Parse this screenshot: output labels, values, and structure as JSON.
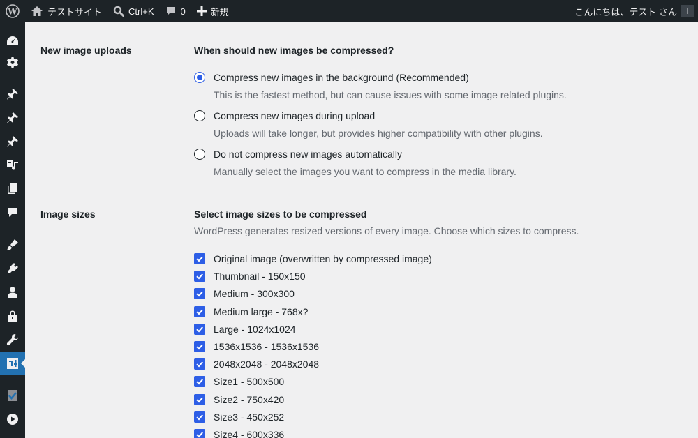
{
  "adminbar": {
    "site_name": "テストサイト",
    "search_shortcut": "Ctrl+K",
    "comments_count": "0",
    "new_label": "新規",
    "greeting": "こんにちは、テスト さん",
    "avatar_letter": "T"
  },
  "sidebar": {
    "items": [
      {
        "icon": "dashboard-icon"
      },
      {
        "icon": "gear-icon"
      },
      {
        "icon": "pin-icon"
      },
      {
        "icon": "pin-icon"
      },
      {
        "icon": "pin-icon"
      },
      {
        "icon": "media-icon"
      },
      {
        "icon": "pages-icon"
      },
      {
        "icon": "comments-icon"
      },
      {
        "icon": "appearance-icon"
      },
      {
        "icon": "plugins-icon"
      },
      {
        "icon": "users-icon"
      },
      {
        "icon": "lock-icon"
      },
      {
        "icon": "tools-icon"
      },
      {
        "icon": "settings-icon",
        "current": true
      },
      {
        "icon": "shield-check-icon"
      },
      {
        "icon": "play-icon"
      }
    ]
  },
  "new_uploads": {
    "label": "New image uploads",
    "question": "When should new images be compressed?",
    "options": [
      {
        "label": "Compress new images in the background (Recommended)",
        "desc": "This is the fastest method, but can cause issues with some image related plugins.",
        "checked": true
      },
      {
        "label": "Compress new images during upload",
        "desc": "Uploads will take longer, but provides higher compatibility with other plugins.",
        "checked": false
      },
      {
        "label": "Do not compress new images automatically",
        "desc": "Manually select the images you want to compress in the media library.",
        "checked": false
      }
    ]
  },
  "image_sizes": {
    "label": "Image sizes",
    "title": "Select image sizes to be compressed",
    "desc": "WordPress generates resized versions of every image. Choose which sizes to compress.",
    "sizes": [
      "Original image (overwritten by compressed image)",
      "Thumbnail - 150x150",
      "Medium - 300x300",
      "Medium large - 768x?",
      "Large - 1024x1024",
      "1536x1536 - 1536x1536",
      "2048x2048 - 2048x2048",
      "Size1 - 500x500",
      "Size2 - 750x420",
      "Size3 - 450x252",
      "Size4 - 600x336"
    ]
  },
  "colors": {
    "adminbar_bg": "#1d2327",
    "accent": "#2d5ee6",
    "page_bg": "#f0f0f1"
  }
}
